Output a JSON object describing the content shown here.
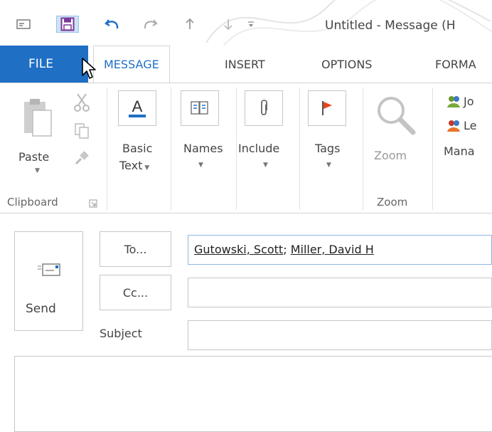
{
  "window": {
    "title": "Untitled - Message (H"
  },
  "tabs": [
    {
      "label": "FILE"
    },
    {
      "label": "MESSAGE"
    },
    {
      "label": "INSERT"
    },
    {
      "label": "OPTIONS"
    },
    {
      "label": "FORMA"
    }
  ],
  "ribbon": {
    "clipboard": {
      "paste": "Paste",
      "group": "Clipboard"
    },
    "basic_text": {
      "line1": "Basic",
      "line2": "Text"
    },
    "names": {
      "label": "Names"
    },
    "include": {
      "label": "Include"
    },
    "tags": {
      "label": "Tags"
    },
    "zoom": {
      "label": "Zoom",
      "group": "Zoom"
    },
    "move": {
      "item1": "Jo",
      "item2": "Le",
      "manage": "Mana"
    }
  },
  "compose": {
    "send_label": "Send",
    "to_button": "To...",
    "cc_button": "Cc...",
    "subject_label": "Subject",
    "recipients": [
      "Gutowski, Scott",
      "Miller, David H"
    ],
    "recipient_separator": "; "
  },
  "colors": {
    "accent": "#1f6fc5",
    "file_tab": "#1f6fc5",
    "tags_flag": "#e8431c"
  }
}
